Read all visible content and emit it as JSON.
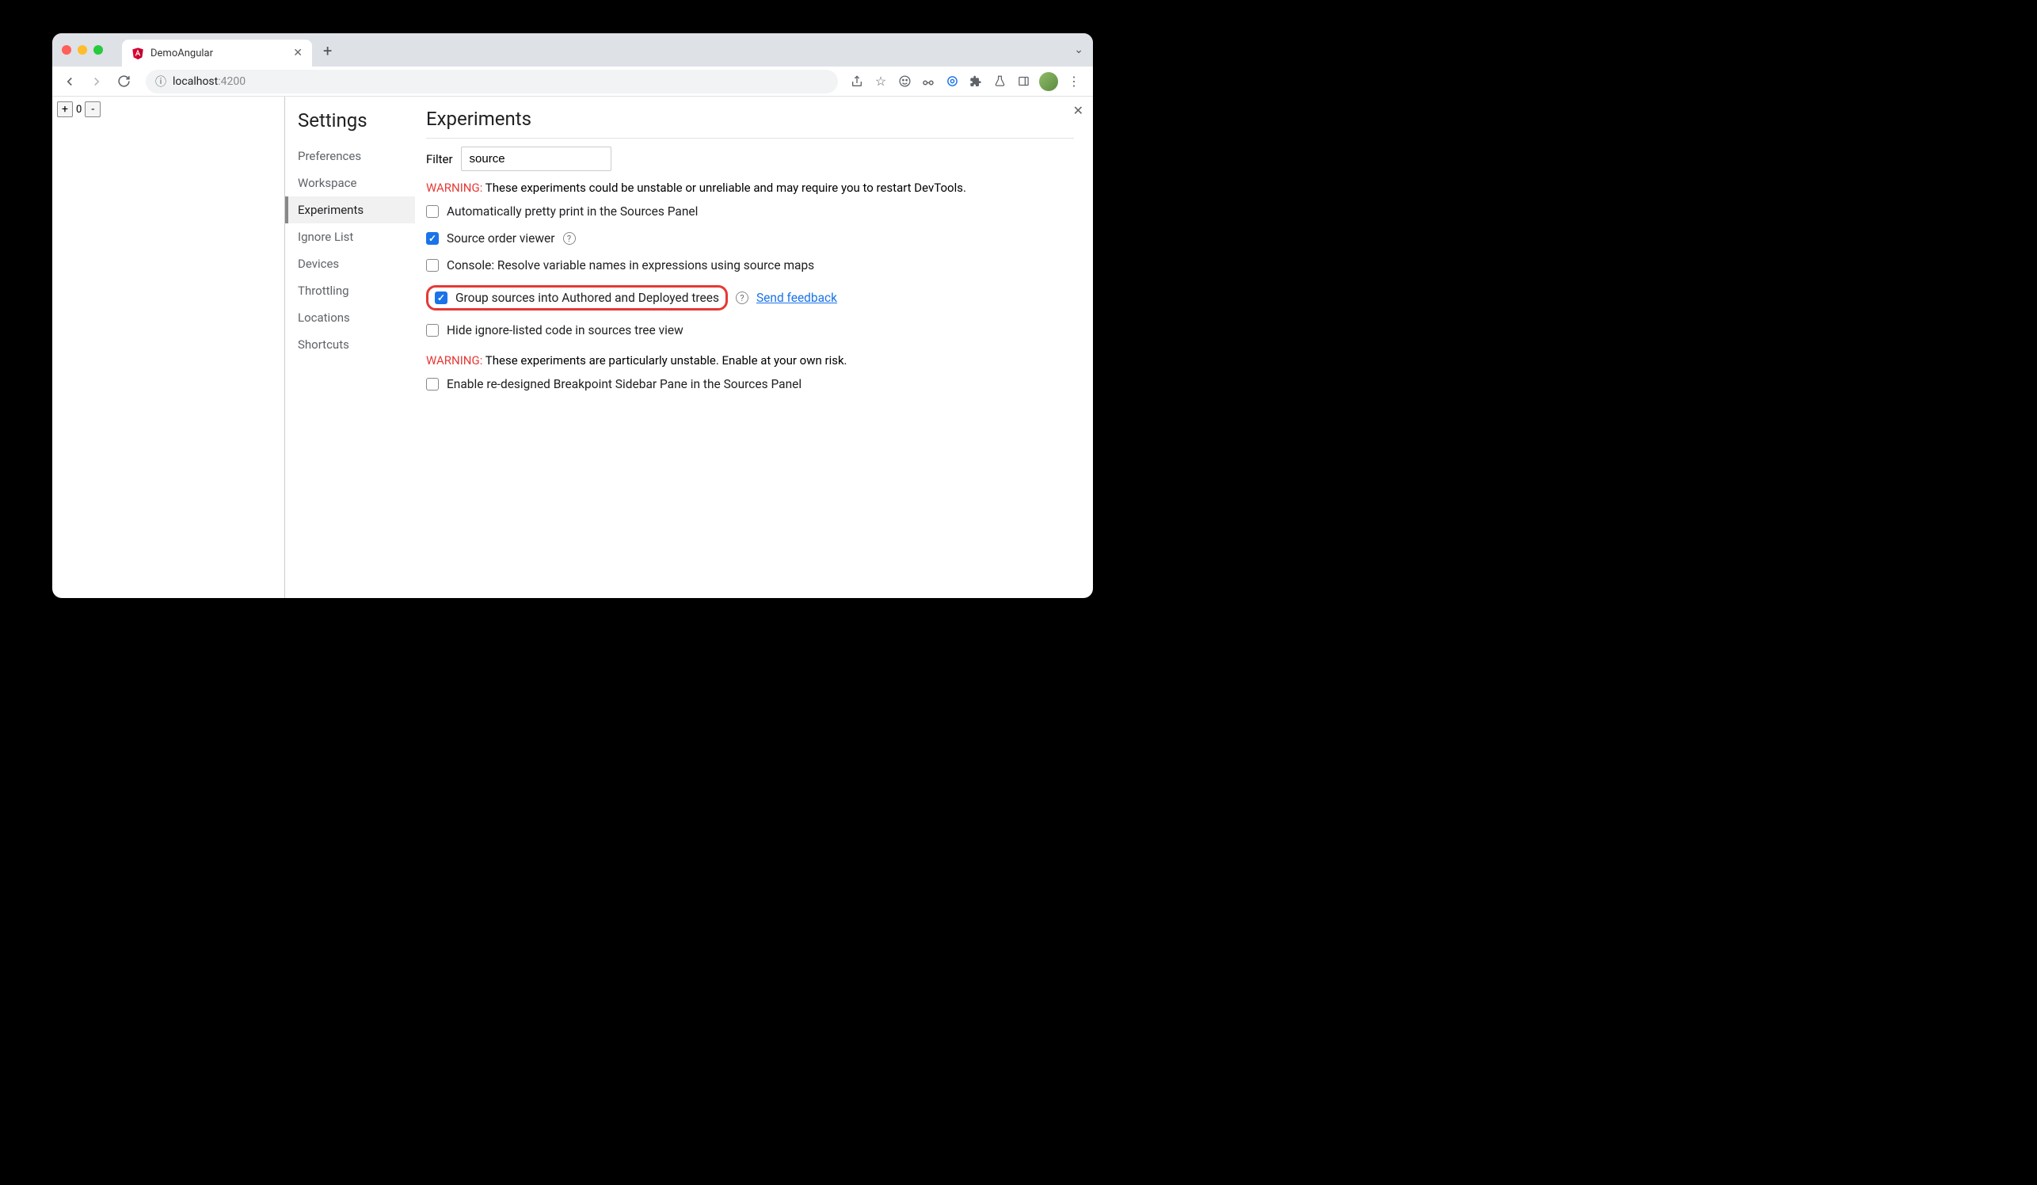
{
  "browser": {
    "tab_title": "DemoAngular",
    "url_host": "localhost",
    "url_port": ":4200"
  },
  "page": {
    "counter_value": "0",
    "plus": "+",
    "minus": "-"
  },
  "settings": {
    "title": "Settings",
    "nav": [
      {
        "label": "Preferences"
      },
      {
        "label": "Workspace"
      },
      {
        "label": "Experiments",
        "active": true
      },
      {
        "label": "Ignore List"
      },
      {
        "label": "Devices"
      },
      {
        "label": "Throttling"
      },
      {
        "label": "Locations"
      },
      {
        "label": "Shortcuts"
      }
    ]
  },
  "experiments": {
    "title": "Experiments",
    "filter_label": "Filter",
    "filter_value": "source",
    "warning1_prefix": "WARNING:",
    "warning1_text": " These experiments could be unstable or unreliable and may require you to restart DevTools.",
    "items": [
      {
        "label": "Automatically pretty print in the Sources Panel",
        "checked": false,
        "help": false
      },
      {
        "label": "Source order viewer",
        "checked": true,
        "help": true
      },
      {
        "label": "Console: Resolve variable names in expressions using source maps",
        "checked": false,
        "help": false
      },
      {
        "label": "Group sources into Authored and Deployed trees",
        "checked": true,
        "help": true,
        "highlight": true,
        "feedback": true
      },
      {
        "label": "Hide ignore-listed code in sources tree view",
        "checked": false,
        "help": false
      }
    ],
    "warning2_prefix": "WARNING:",
    "warning2_text": " These experiments are particularly unstable. Enable at your own risk.",
    "unstable_items": [
      {
        "label": "Enable re-designed Breakpoint Sidebar Pane in the Sources Panel",
        "checked": false
      }
    ],
    "feedback_label": "Send feedback"
  }
}
